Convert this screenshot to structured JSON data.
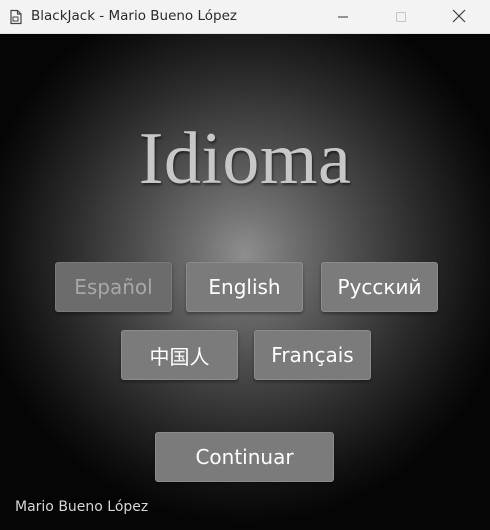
{
  "window": {
    "title": "BlackJack - Mario Bueno López",
    "icons": {
      "app": "app-document-icon",
      "minimize": "minimize-icon",
      "maximize": "maximize-icon",
      "close": "close-icon"
    }
  },
  "main": {
    "heading": "Idioma",
    "languages": [
      {
        "label": "Español",
        "state": "disabled"
      },
      {
        "label": "English",
        "state": "enabled"
      },
      {
        "label": "Русский",
        "state": "enabled"
      },
      {
        "label": "中国人",
        "state": "enabled"
      },
      {
        "label": "Français",
        "state": "enabled"
      }
    ],
    "continue_label": "Continuar"
  },
  "footer": {
    "author": "Mario Bueno López"
  },
  "colors": {
    "button_bg": "#7b7b7b",
    "button_text": "#ffffff",
    "disabled_text": "#a8a8a8",
    "heading_text": "#c7c7c7",
    "titlebar_bg": "#f3f3f3"
  }
}
